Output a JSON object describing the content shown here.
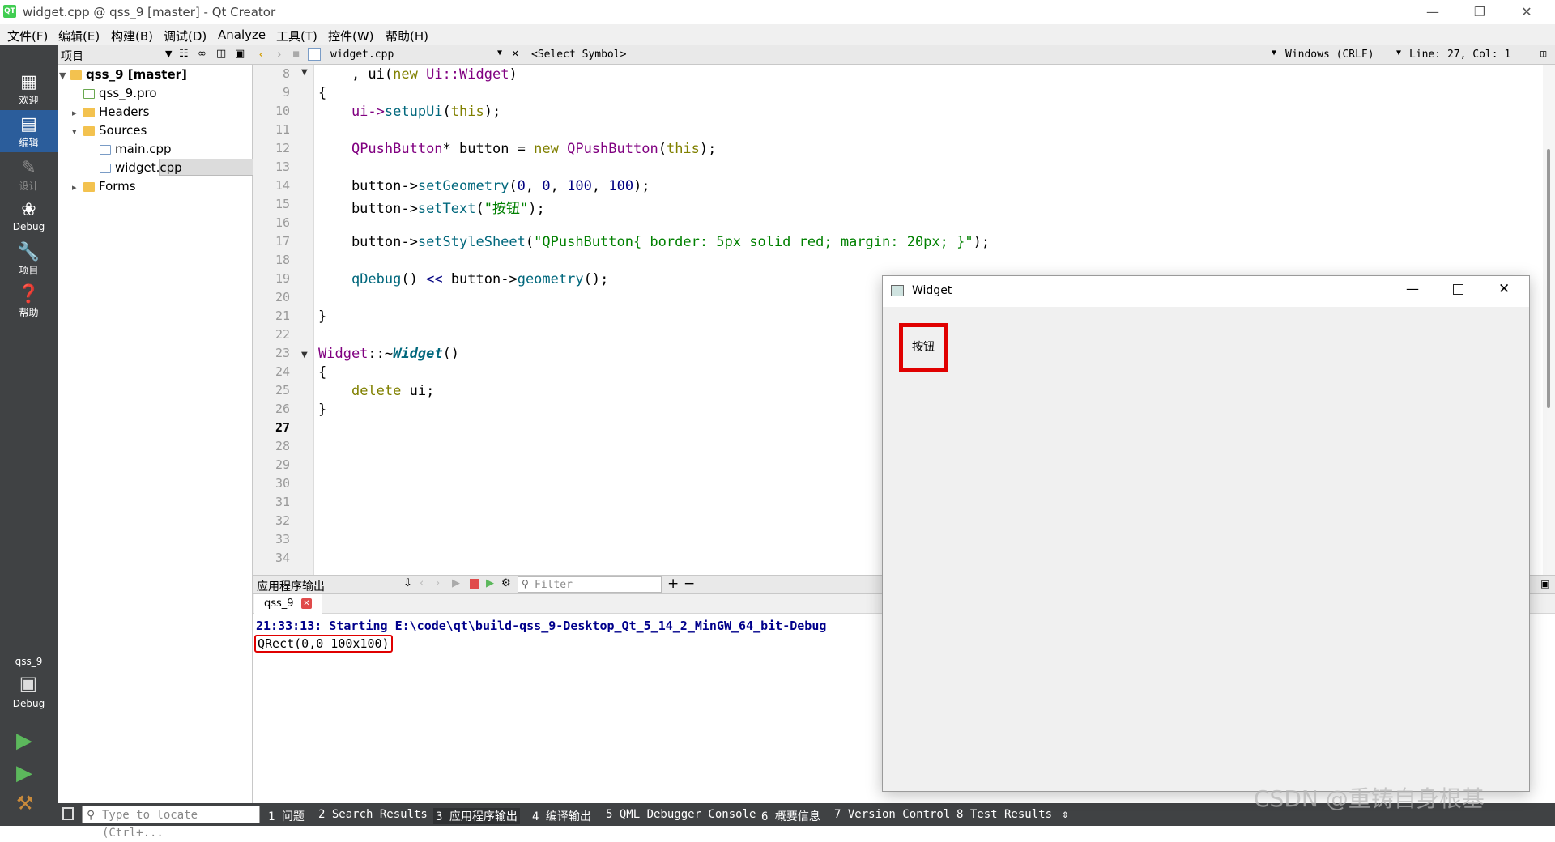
{
  "window": {
    "title": "widget.cpp @ qss_9 [master] - Qt Creator",
    "app_icon": "QT"
  },
  "menu": [
    "文件(F)",
    "编辑(E)",
    "构建(B)",
    "调试(D)",
    "Analyze",
    "工具(T)",
    "控件(W)",
    "帮助(H)"
  ],
  "modes": [
    {
      "label": "欢迎",
      "icon": "grid-icon"
    },
    {
      "label": "编辑",
      "icon": "edit-icon"
    },
    {
      "label": "设计",
      "icon": "pencil-icon"
    },
    {
      "label": "Debug",
      "icon": "bug-icon"
    },
    {
      "label": "项目",
      "icon": "wrench-icon"
    },
    {
      "label": "帮助",
      "icon": "help-icon"
    }
  ],
  "target": {
    "project": "qss_9",
    "config": "Debug"
  },
  "project_pane": {
    "header": "项目",
    "tree": [
      {
        "label": "qss_9 [master]"
      },
      {
        "label": "qss_9.pro"
      },
      {
        "label": "Headers"
      },
      {
        "label": "Sources"
      },
      {
        "label": "main.cpp"
      },
      {
        "label": "widget.cpp"
      },
      {
        "label": "Forms"
      }
    ]
  },
  "editor": {
    "file": "widget.cpp",
    "symbol": "<Select Symbol>",
    "line_ending": "Windows (CRLF)",
    "position": "Line: 27, Col: 1",
    "line_numbers": [
      "8",
      "9",
      "10",
      "11",
      "12",
      "13",
      "14",
      "15",
      "16",
      "17",
      "18",
      "19",
      "20",
      "21",
      "22",
      "23",
      "24",
      "25",
      "26",
      "27",
      "28",
      "29",
      "30",
      "31",
      "32",
      "33",
      "34"
    ],
    "current_line": "27"
  },
  "code": {
    "l8": [
      "    , ui(",
      "new",
      " Ui::",
      "Widget",
      ")"
    ],
    "l9": "{",
    "l10": [
      "    ui->",
      "setupUi",
      "(",
      "this",
      ");"
    ],
    "l12": [
      "    ",
      "QPushButton",
      "* button = ",
      "new",
      " ",
      "QPushButton",
      "(",
      "this",
      ");"
    ],
    "l14": [
      "    button->",
      "setGeometry",
      "(",
      "0",
      ", ",
      "0",
      ", ",
      "100",
      ", ",
      "100",
      ");"
    ],
    "l15": [
      "    button->",
      "setText",
      "(",
      "\"按钮\"",
      ");"
    ],
    "l17": [
      "    button->",
      "setStyleSheet",
      "(",
      "\"QPushButton{ border: 5px solid red; margin: 20px; }\"",
      ");"
    ],
    "l19": [
      "    ",
      "qDebug",
      "() ",
      "<<",
      " button->",
      "geometry",
      "();"
    ],
    "l21": "}",
    "l23": [
      "Widget",
      "::~",
      "Widget",
      "()"
    ],
    "l24": "{",
    "l25": [
      "    ",
      "delete",
      " ui;"
    ],
    "l26": "}"
  },
  "output": {
    "header": "应用程序输出",
    "filter_placeholder": "Filter",
    "tab": "qss_9",
    "line1": "21:33:13: Starting E:\\code\\qt\\build-qss_9-Desktop_Qt_5_14_2_MinGW_64_bit-Debug",
    "line2": "QRect(0,0 100x100)"
  },
  "statusbar": {
    "locate_placeholder": "Type to locate (Ctrl+...",
    "tabs": [
      "1 问题",
      "2 Search Results",
      "3 应用程序输出",
      "4 编译输出",
      "5 QML Debugger Console",
      "6 概要信息",
      "7 Version Control",
      "8 Test Results"
    ]
  },
  "widget_window": {
    "title": "Widget",
    "button_text": "按钮",
    "button_border_color": "#e00000"
  },
  "watermark": "CSDN @重铸自身根基"
}
